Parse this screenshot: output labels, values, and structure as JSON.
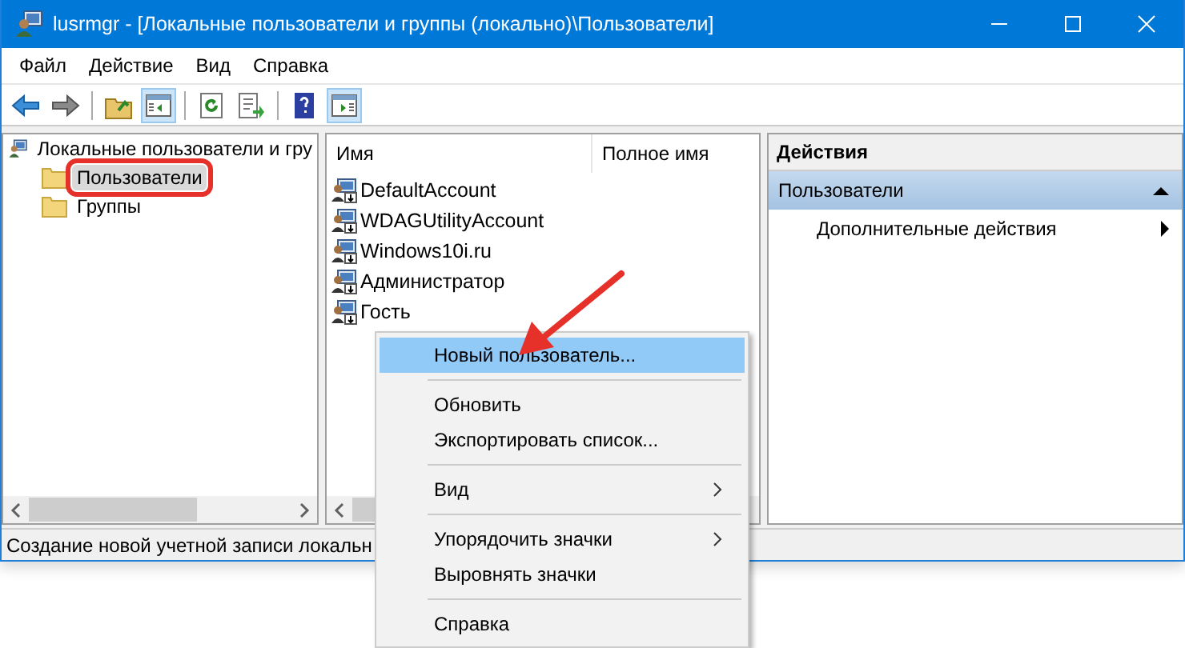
{
  "window": {
    "title": "lusrmgr - [Локальные пользователи и группы (локально)\\Пользователи]"
  },
  "menu": [
    "Файл",
    "Действие",
    "Вид",
    "Справка"
  ],
  "toolbar": [
    {
      "kind": "back",
      "pressed": false
    },
    {
      "kind": "forward",
      "pressed": false
    },
    {
      "kind": "sep"
    },
    {
      "kind": "up",
      "pressed": false
    },
    {
      "kind": "tree",
      "pressed": true
    },
    {
      "kind": "sep"
    },
    {
      "kind": "refresh",
      "pressed": false
    },
    {
      "kind": "export",
      "pressed": false
    },
    {
      "kind": "sep"
    },
    {
      "kind": "help",
      "pressed": false
    },
    {
      "kind": "actions",
      "pressed": true
    }
  ],
  "tree": {
    "label": "Локальные пользователи и гру",
    "children": [
      {
        "label": "Пользователи",
        "selected": true,
        "highlighted": true
      },
      {
        "label": "Группы",
        "selected": false,
        "highlighted": false
      }
    ]
  },
  "list": {
    "columns": [
      "Имя",
      "Полное имя"
    ],
    "rows": [
      "DefaultAccount",
      "WDAGUtilityAccount",
      "Windows10i.ru",
      "Администратор",
      "Гость"
    ]
  },
  "actions": {
    "title": "Действия",
    "section": "Пользователи",
    "items": [
      "Дополнительные действия"
    ]
  },
  "status_bar": "Создание новой учетной записи локальн",
  "context_menu": [
    {
      "kind": "item",
      "label": "Новый пользователь...",
      "selected": true,
      "submenu": false
    },
    {
      "kind": "separator"
    },
    {
      "kind": "item",
      "label": "Обновить",
      "selected": false,
      "submenu": false
    },
    {
      "kind": "item",
      "label": "Экспортировать список...",
      "selected": false,
      "submenu": false
    },
    {
      "kind": "separator"
    },
    {
      "kind": "item",
      "label": "Вид",
      "selected": false,
      "submenu": true
    },
    {
      "kind": "separator"
    },
    {
      "kind": "item",
      "label": "Упорядочить значки",
      "selected": false,
      "submenu": true
    },
    {
      "kind": "item",
      "label": "Выровнять значки",
      "selected": false,
      "submenu": false
    },
    {
      "kind": "separator"
    },
    {
      "kind": "item",
      "label": "Справка",
      "selected": false,
      "submenu": false
    }
  ]
}
